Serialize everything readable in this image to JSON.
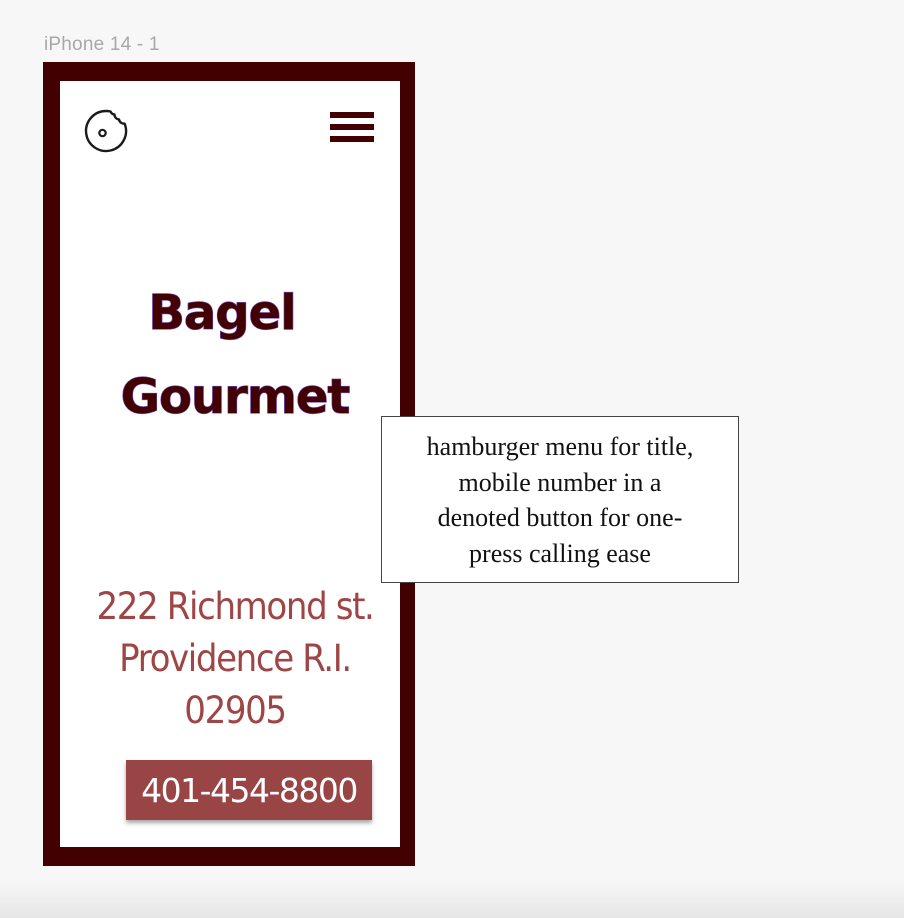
{
  "frame": {
    "label": "iPhone 14 - 1"
  },
  "header": {
    "logo_icon": "bagel-icon",
    "menu_icon": "hamburger-menu-icon"
  },
  "title": {
    "line1": "Bagel",
    "line2": "Gourmet"
  },
  "address": {
    "line1": "222 Richmond st.",
    "line2": "Providence R.I.",
    "line3": "02905"
  },
  "phone_button": {
    "label": "401-454-8800"
  },
  "note": {
    "lines": [
      "hamburger menu for title,",
      "mobile number in a",
      "denoted button for one-",
      "press calling ease"
    ]
  },
  "colors": {
    "frame": "#420000",
    "title": "#420000",
    "address": "#9e4545",
    "button": "#9a4545",
    "canvas": "#f7f7f7"
  }
}
